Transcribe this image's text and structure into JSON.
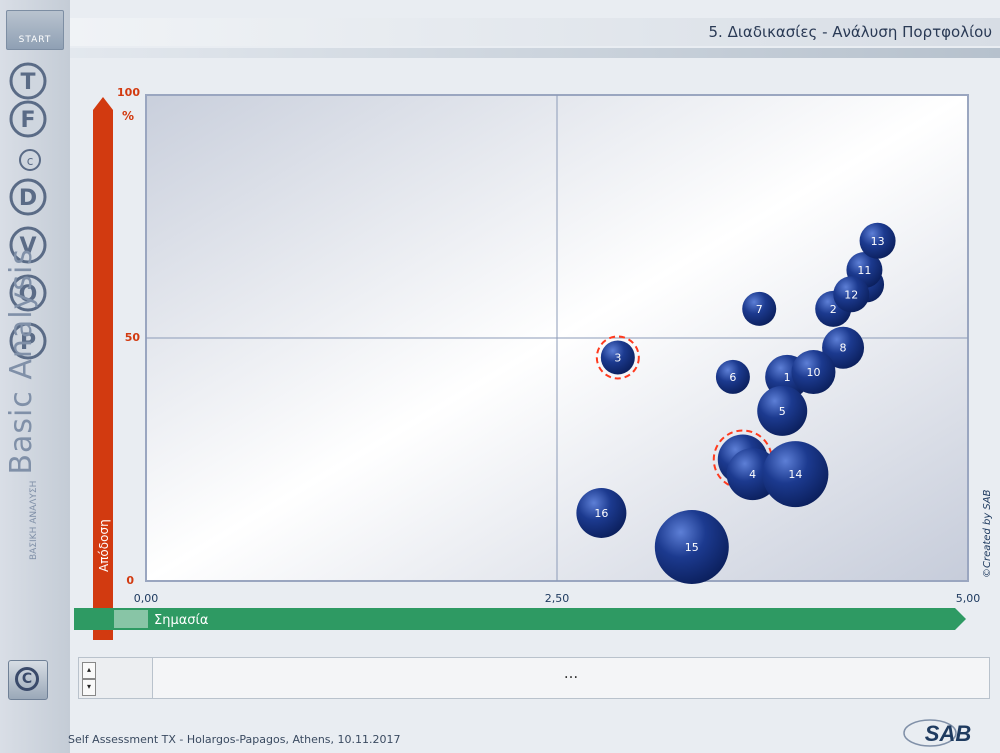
{
  "header": {
    "title": "5. Διαδικασίες - Ανάλυση Πορτφολίου"
  },
  "sidebar": {
    "start_label": "START",
    "title": "Basic Analysis",
    "subtitle": "ΒΑΣΙΚΗ ΑΝΑΛΥΣΗ",
    "icons": [
      "tqm-icon",
      "fm-icon",
      "c-icon",
      "dm-icon",
      "vm-icon",
      "om-icon",
      "prioritising-icon"
    ],
    "copyright_icon": "copyright-icon"
  },
  "chart_data": {
    "type": "scatter",
    "xlabel": "Σημασία",
    "ylabel": "Απόδοση",
    "y_unit": "%",
    "xlim": [
      0,
      5
    ],
    "ylim": [
      0,
      100
    ],
    "x_ticks": [
      "0,00",
      "2,50",
      "5,00"
    ],
    "y_ticks": [
      "0",
      "50",
      "100"
    ],
    "grid": false,
    "quadrant_lines": {
      "x": 2.5,
      "y": 50
    },
    "watermark": "©Created by SAB",
    "points": [
      {
        "label": "1",
        "x": 3.9,
        "y": 42,
        "size": 22,
        "highlighted": false
      },
      {
        "label": "2",
        "x": 4.18,
        "y": 56,
        "size": 18,
        "highlighted": false
      },
      {
        "label": "3",
        "x": 2.87,
        "y": 46,
        "size": 17,
        "highlighted": true
      },
      {
        "label": "4",
        "x": 3.69,
        "y": 22,
        "size": 26,
        "highlighted": false
      },
      {
        "label": "5",
        "x": 3.87,
        "y": 35,
        "size": 25,
        "highlighted": false
      },
      {
        "label": "6",
        "x": 3.57,
        "y": 42,
        "size": 17,
        "highlighted": false
      },
      {
        "label": "7",
        "x": 3.73,
        "y": 56,
        "size": 17,
        "highlighted": false
      },
      {
        "label": "8",
        "x": 4.24,
        "y": 48,
        "size": 21,
        "highlighted": false
      },
      {
        "label": "9",
        "x": 4.38,
        "y": 61,
        "size": 18,
        "highlighted": false
      },
      {
        "label": "10",
        "x": 4.06,
        "y": 43,
        "size": 22,
        "highlighted": false
      },
      {
        "label": "11",
        "x": 4.37,
        "y": 64,
        "size": 18,
        "highlighted": false
      },
      {
        "label": "12",
        "x": 4.29,
        "y": 59,
        "size": 18,
        "highlighted": false
      },
      {
        "label": "13",
        "x": 4.45,
        "y": 70,
        "size": 18,
        "highlighted": false
      },
      {
        "label": "14",
        "x": 3.95,
        "y": 22,
        "size": 33,
        "highlighted": false
      },
      {
        "label": "15",
        "x": 3.32,
        "y": 7,
        "size": 37,
        "highlighted": false
      },
      {
        "label": "16",
        "x": 2.77,
        "y": 14,
        "size": 25,
        "highlighted": false
      },
      {
        "label": "17",
        "x": 3.63,
        "y": 25,
        "size": 25,
        "highlighted": true
      }
    ]
  },
  "bottom": {
    "text": "..."
  },
  "footer": {
    "text": "Self Assessment TX - Holargos-Papagos, Athens, 10.11.2017"
  },
  "logo": {
    "text": "SAB"
  },
  "colors": {
    "bubble": "#1c3a8f",
    "bubble_dark": "#0b1f5c",
    "highlight": "#ff3b1f",
    "y_axis": "#d23a10",
    "x_axis": "#2e9a63"
  }
}
